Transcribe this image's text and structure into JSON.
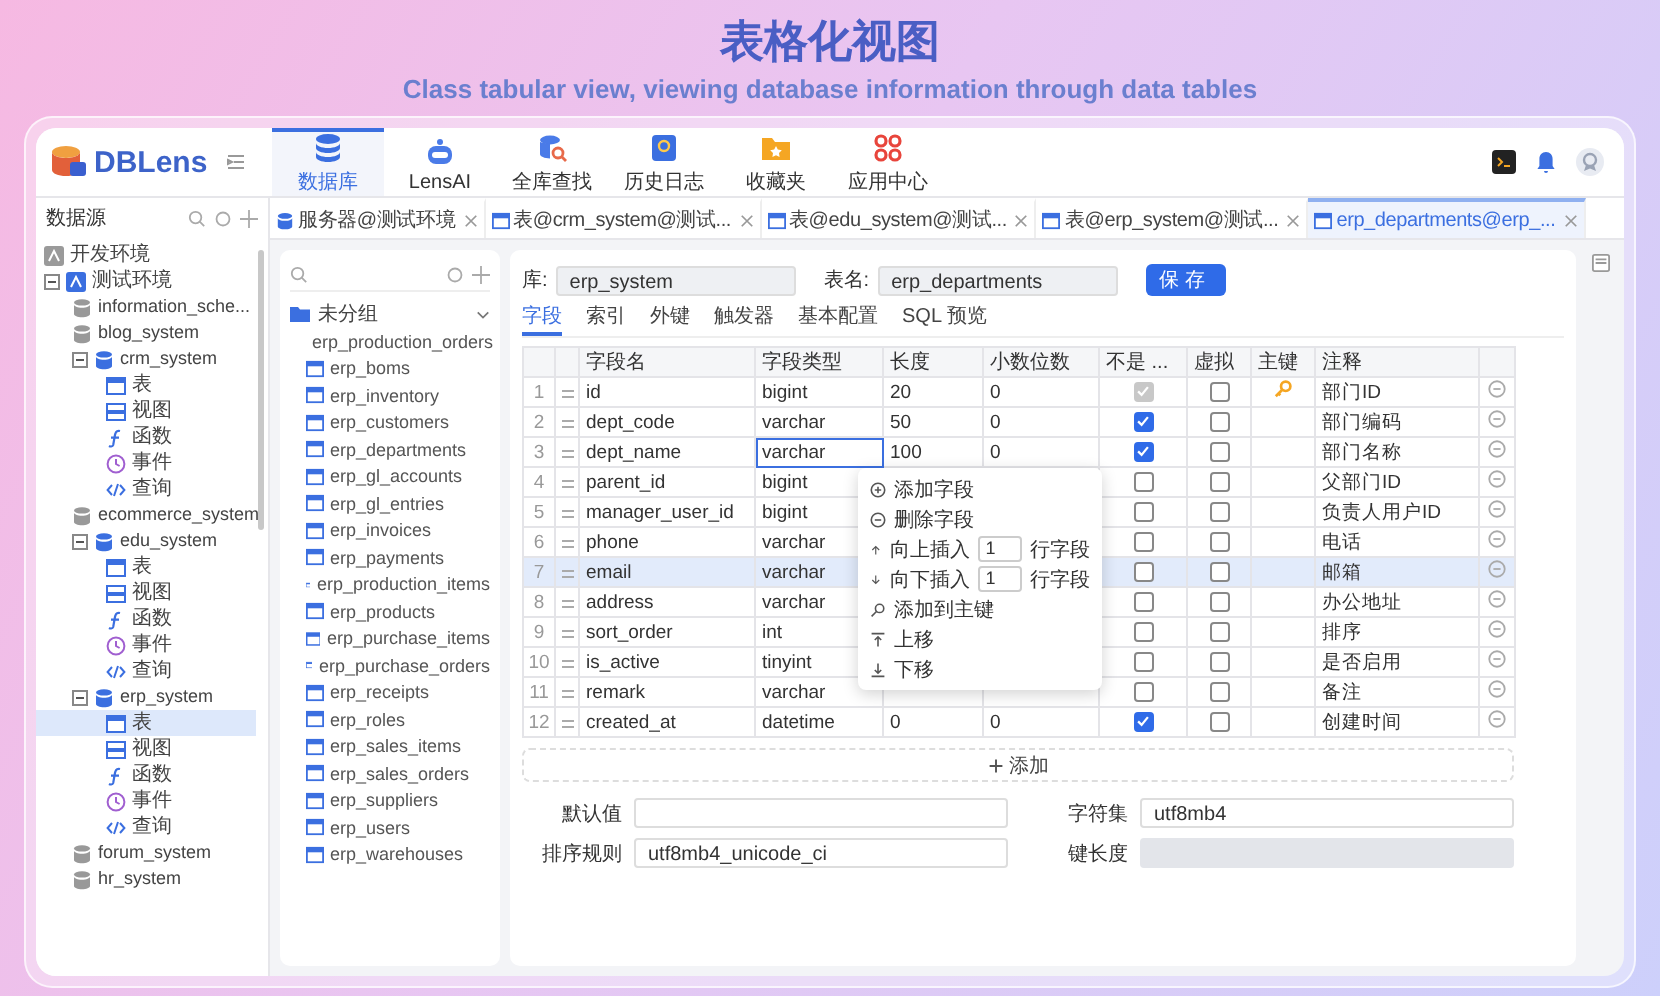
{
  "title": "表格化视图",
  "subtitle": "Class tabular view, viewing database information through data tables",
  "app": {
    "logo": "DBLens",
    "nav": [
      {
        "label": "数据库",
        "kind": "database",
        "selected": true
      },
      {
        "label": "LensAI",
        "kind": "ai",
        "selected": false
      },
      {
        "label": "全库查找",
        "kind": "search",
        "selected": false
      },
      {
        "label": "历史日志",
        "kind": "history",
        "selected": false
      },
      {
        "label": "收藏夹",
        "kind": "favorites",
        "selected": false
      },
      {
        "label": "应用中心",
        "kind": "apps",
        "selected": false
      }
    ],
    "sidebar": {
      "title": "数据源",
      "tree": [
        {
          "label": "开发环境",
          "kind": "env",
          "connected": false,
          "expanded": false,
          "selected": false
        },
        {
          "label": "测试环境",
          "kind": "env",
          "connected": true,
          "expanded": true,
          "selected": false,
          "children": [
            {
              "label": "information_sche...",
              "kind": "db",
              "expanded": false,
              "selected": false
            },
            {
              "label": "blog_system",
              "kind": "db",
              "expanded": false,
              "selected": false
            },
            {
              "label": "crm_system",
              "kind": "db",
              "expanded": true,
              "selected": false,
              "children": [
                {
                  "label": "表",
                  "kind": "table",
                  "selected": false
                },
                {
                  "label": "视图",
                  "kind": "view",
                  "selected": false
                },
                {
                  "label": "函数",
                  "kind": "function",
                  "selected": false
                },
                {
                  "label": "事件",
                  "kind": "event",
                  "selected": false
                },
                {
                  "label": "查询",
                  "kind": "query",
                  "selected": false
                }
              ]
            },
            {
              "label": "ecommerce_system",
              "kind": "db",
              "expanded": false,
              "selected": false
            },
            {
              "label": "edu_system",
              "kind": "db",
              "expanded": true,
              "selected": false,
              "children": [
                {
                  "label": "表",
                  "kind": "table",
                  "selected": false
                },
                {
                  "label": "视图",
                  "kind": "view",
                  "selected": false
                },
                {
                  "label": "函数",
                  "kind": "function",
                  "selected": false
                },
                {
                  "label": "事件",
                  "kind": "event",
                  "selected": false
                },
                {
                  "label": "查询",
                  "kind": "query",
                  "selected": false
                }
              ]
            },
            {
              "label": "erp_system",
              "kind": "db",
              "expanded": true,
              "selected": false,
              "children": [
                {
                  "label": "表",
                  "kind": "table",
                  "selected": true
                },
                {
                  "label": "视图",
                  "kind": "view",
                  "selected": false
                },
                {
                  "label": "函数",
                  "kind": "function",
                  "selected": false
                },
                {
                  "label": "事件",
                  "kind": "event",
                  "selected": false
                },
                {
                  "label": "查询",
                  "kind": "query",
                  "selected": false
                }
              ]
            },
            {
              "label": "forum_system",
              "kind": "db",
              "expanded": false,
              "selected": false
            },
            {
              "label": "hr_system",
              "kind": "db",
              "expanded": false,
              "selected": false
            }
          ]
        }
      ]
    },
    "tabs": [
      {
        "label": "服务器@测试环境",
        "kind": "server",
        "selected": false
      },
      {
        "label": "表@crm_system@测试...",
        "kind": "table",
        "selected": false
      },
      {
        "label": "表@edu_system@测试...",
        "kind": "table",
        "selected": false
      },
      {
        "label": "表@erp_system@测试...",
        "kind": "table",
        "selected": false
      },
      {
        "label": "erp_departments@erp_...",
        "kind": "table",
        "selected": true
      }
    ],
    "table_list": {
      "group": "未分组",
      "expanded": true,
      "items": [
        "erp_production_orders",
        "erp_boms",
        "erp_inventory",
        "erp_customers",
        "erp_departments",
        "erp_gl_accounts",
        "erp_gl_entries",
        "erp_invoices",
        "erp_payments",
        "erp_production_items",
        "erp_products",
        "erp_purchase_items",
        "erp_purchase_orders",
        "erp_receipts",
        "erp_roles",
        "erp_sales_items",
        "erp_sales_orders",
        "erp_suppliers",
        "erp_users",
        "erp_warehouses"
      ]
    },
    "editor": {
      "db_label": "库:",
      "db_value": "erp_system",
      "table_label": "表名:",
      "table_value": "erp_departments",
      "save": "保存",
      "subtabs": [
        {
          "label": "字段",
          "selected": true
        },
        {
          "label": "索引",
          "selected": false
        },
        {
          "label": "外键",
          "selected": false
        },
        {
          "label": "触发器",
          "selected": false
        },
        {
          "label": "基本配置",
          "selected": false
        },
        {
          "label": "SQL 预览",
          "selected": false
        }
      ],
      "columns": [
        "字段名",
        "字段类型",
        "长度",
        "小数位数",
        "不是 ...",
        "虚拟",
        "主键",
        "注释"
      ],
      "rows": [
        {
          "no": "1",
          "name": "id",
          "type": "bigint",
          "length": "20",
          "decimals": "0",
          "not_null": true,
          "virtual": false,
          "primary_key": true,
          "comment": "部门ID",
          "selected": false,
          "editing": false
        },
        {
          "no": "2",
          "name": "dept_code",
          "type": "varchar",
          "length": "50",
          "decimals": "0",
          "not_null": true,
          "virtual": false,
          "primary_key": false,
          "comment": "部门编码",
          "selected": false,
          "editing": false
        },
        {
          "no": "3",
          "name": "dept_name",
          "type": "varchar",
          "length": "100",
          "decimals": "0",
          "not_null": true,
          "virtual": false,
          "primary_key": false,
          "comment": "部门名称",
          "selected": false,
          "editing": true
        },
        {
          "no": "4",
          "name": "parent_id",
          "type": "bigint",
          "not_null": false,
          "virtual": false,
          "primary_key": false,
          "comment": "父部门ID",
          "selected": false,
          "editing": false
        },
        {
          "no": "5",
          "name": "manager_user_id",
          "type": "bigint",
          "not_null": false,
          "virtual": false,
          "primary_key": false,
          "comment": "负责人用户ID",
          "selected": false,
          "editing": false
        },
        {
          "no": "6",
          "name": "phone",
          "type": "varchar",
          "not_null": false,
          "virtual": false,
          "primary_key": false,
          "comment": "电话",
          "selected": false,
          "editing": false
        },
        {
          "no": "7",
          "name": "email",
          "type": "varchar",
          "not_null": false,
          "virtual": false,
          "primary_key": false,
          "comment": "邮箱",
          "selected": true,
          "editing": false
        },
        {
          "no": "8",
          "name": "address",
          "type": "varchar",
          "not_null": false,
          "virtual": false,
          "primary_key": false,
          "comment": "办公地址",
          "selected": false,
          "editing": false
        },
        {
          "no": "9",
          "name": "sort_order",
          "type": "int",
          "not_null": false,
          "virtual": false,
          "primary_key": false,
          "comment": "排序",
          "selected": false,
          "editing": false
        },
        {
          "no": "10",
          "name": "is_active",
          "type": "tinyint",
          "not_null": false,
          "virtual": false,
          "primary_key": false,
          "comment": "是否启用",
          "selected": false,
          "editing": false
        },
        {
          "no": "11",
          "name": "remark",
          "type": "varchar",
          "not_null": false,
          "virtual": false,
          "primary_key": false,
          "comment": "备注",
          "selected": false,
          "editing": false
        },
        {
          "no": "12",
          "name": "created_at",
          "type": "datetime",
          "length": "0",
          "decimals": "0",
          "not_null": true,
          "virtual": false,
          "primary_key": false,
          "comment": "创建时间",
          "selected": false,
          "editing": false
        }
      ],
      "context_menu": [
        {
          "label": "添加字段",
          "kind": "add"
        },
        {
          "label": "删除字段",
          "kind": "delete"
        },
        {
          "label": "向上插入",
          "kind": "insert_above",
          "value": "1",
          "suffix": "行字段"
        },
        {
          "label": "向下插入",
          "kind": "insert_below",
          "value": "1",
          "suffix": "行字段"
        },
        {
          "label": "添加到主键",
          "kind": "primary_key"
        },
        {
          "label": "上移",
          "kind": "move_up"
        },
        {
          "label": "下移",
          "kind": "move_down"
        }
      ],
      "add": "添加",
      "form": [
        {
          "label": "默认值",
          "disabled": false
        },
        {
          "label": "字符集",
          "value": "utf8mb4",
          "disabled": false
        },
        {
          "label": "排序规则",
          "value": "utf8mb4_unicode_ci",
          "disabled": false
        },
        {
          "label": "键长度",
          "disabled": true
        }
      ]
    }
  }
}
